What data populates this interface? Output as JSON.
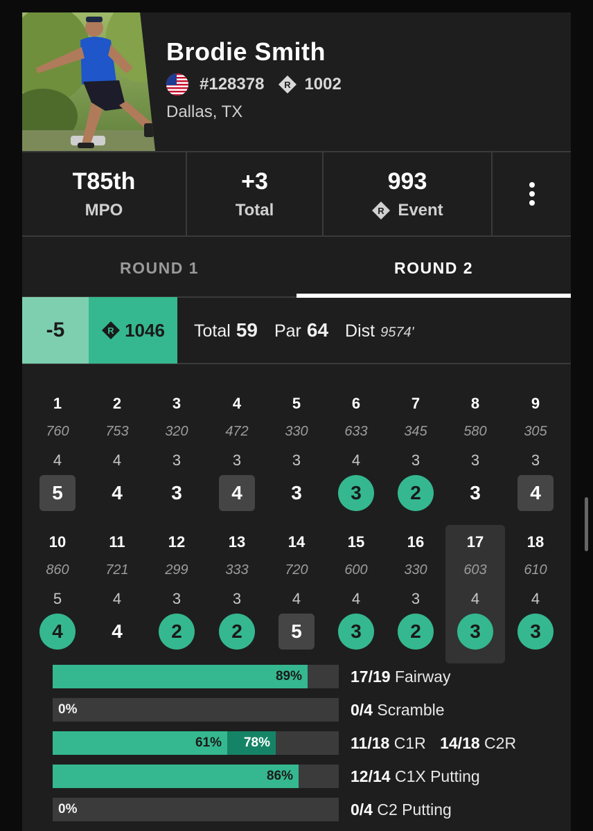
{
  "player": {
    "name": "Brodie Smith",
    "pdga_number": "#128378",
    "rating": "1002",
    "location": "Dallas, TX",
    "country_flag": "us-flag-icon"
  },
  "event_stats": {
    "place": "T85th",
    "division": "MPO",
    "total_score": "+3",
    "total_label": "Total",
    "event_rating": "993",
    "event_label": "Event"
  },
  "tabs": [
    {
      "label": "ROUND 1",
      "active": false
    },
    {
      "label": "ROUND 2",
      "active": true
    }
  ],
  "round_summary": {
    "relative_score": "-5",
    "round_rating": "1046",
    "total_label": "Total",
    "total_value": "59",
    "par_label": "Par",
    "par_value": "64",
    "dist_label": "Dist",
    "dist_value": "9574'"
  },
  "holes": [
    {
      "num": "1",
      "dist": "760",
      "par": "4",
      "score": "5",
      "result": "bogey"
    },
    {
      "num": "2",
      "dist": "753",
      "par": "4",
      "score": "4",
      "result": "par"
    },
    {
      "num": "3",
      "dist": "320",
      "par": "3",
      "score": "3",
      "result": "par"
    },
    {
      "num": "4",
      "dist": "472",
      "par": "3",
      "score": "4",
      "result": "bogey"
    },
    {
      "num": "5",
      "dist": "330",
      "par": "3",
      "score": "3",
      "result": "par"
    },
    {
      "num": "6",
      "dist": "633",
      "par": "4",
      "score": "3",
      "result": "birdie"
    },
    {
      "num": "7",
      "dist": "345",
      "par": "3",
      "score": "2",
      "result": "birdie"
    },
    {
      "num": "8",
      "dist": "580",
      "par": "3",
      "score": "3",
      "result": "par"
    },
    {
      "num": "9",
      "dist": "305",
      "par": "3",
      "score": "4",
      "result": "bogey"
    },
    {
      "num": "10",
      "dist": "860",
      "par": "5",
      "score": "4",
      "result": "birdie"
    },
    {
      "num": "11",
      "dist": "721",
      "par": "4",
      "score": "4",
      "result": "par"
    },
    {
      "num": "12",
      "dist": "299",
      "par": "3",
      "score": "2",
      "result": "birdie"
    },
    {
      "num": "13",
      "dist": "333",
      "par": "3",
      "score": "2",
      "result": "birdie"
    },
    {
      "num": "14",
      "dist": "720",
      "par": "4",
      "score": "5",
      "result": "bogey"
    },
    {
      "num": "15",
      "dist": "600",
      "par": "4",
      "score": "3",
      "result": "birdie"
    },
    {
      "num": "16",
      "dist": "330",
      "par": "3",
      "score": "2",
      "result": "birdie"
    },
    {
      "num": "17",
      "dist": "603",
      "par": "4",
      "score": "3",
      "result": "birdie",
      "highlighted": true
    },
    {
      "num": "18",
      "dist": "610",
      "par": "4",
      "score": "3",
      "result": "birdie"
    }
  ],
  "round_stats": [
    {
      "pct": 89,
      "pct_label": "89%",
      "count": "17/19",
      "label": "Fairway"
    },
    {
      "pct": 0,
      "pct_label": "0%",
      "count": "0/4",
      "label": "Scramble"
    },
    {
      "pct": 61,
      "pct_label": "61%",
      "pct2": 78,
      "pct2_label": "78%",
      "count": "11/18",
      "label": "C1R",
      "count2": "14/18",
      "label2": "C2R"
    },
    {
      "pct": 86,
      "pct_label": "86%",
      "count": "12/14",
      "label": "C1X Putting"
    },
    {
      "pct": 0,
      "pct_label": "0%",
      "count": "0/4",
      "label": "C2 Putting"
    }
  ],
  "colors": {
    "accent": "#35b88f",
    "accent_light": "#7ecfb0",
    "accent_dark": "#158466",
    "background": "#1e1e1e"
  }
}
